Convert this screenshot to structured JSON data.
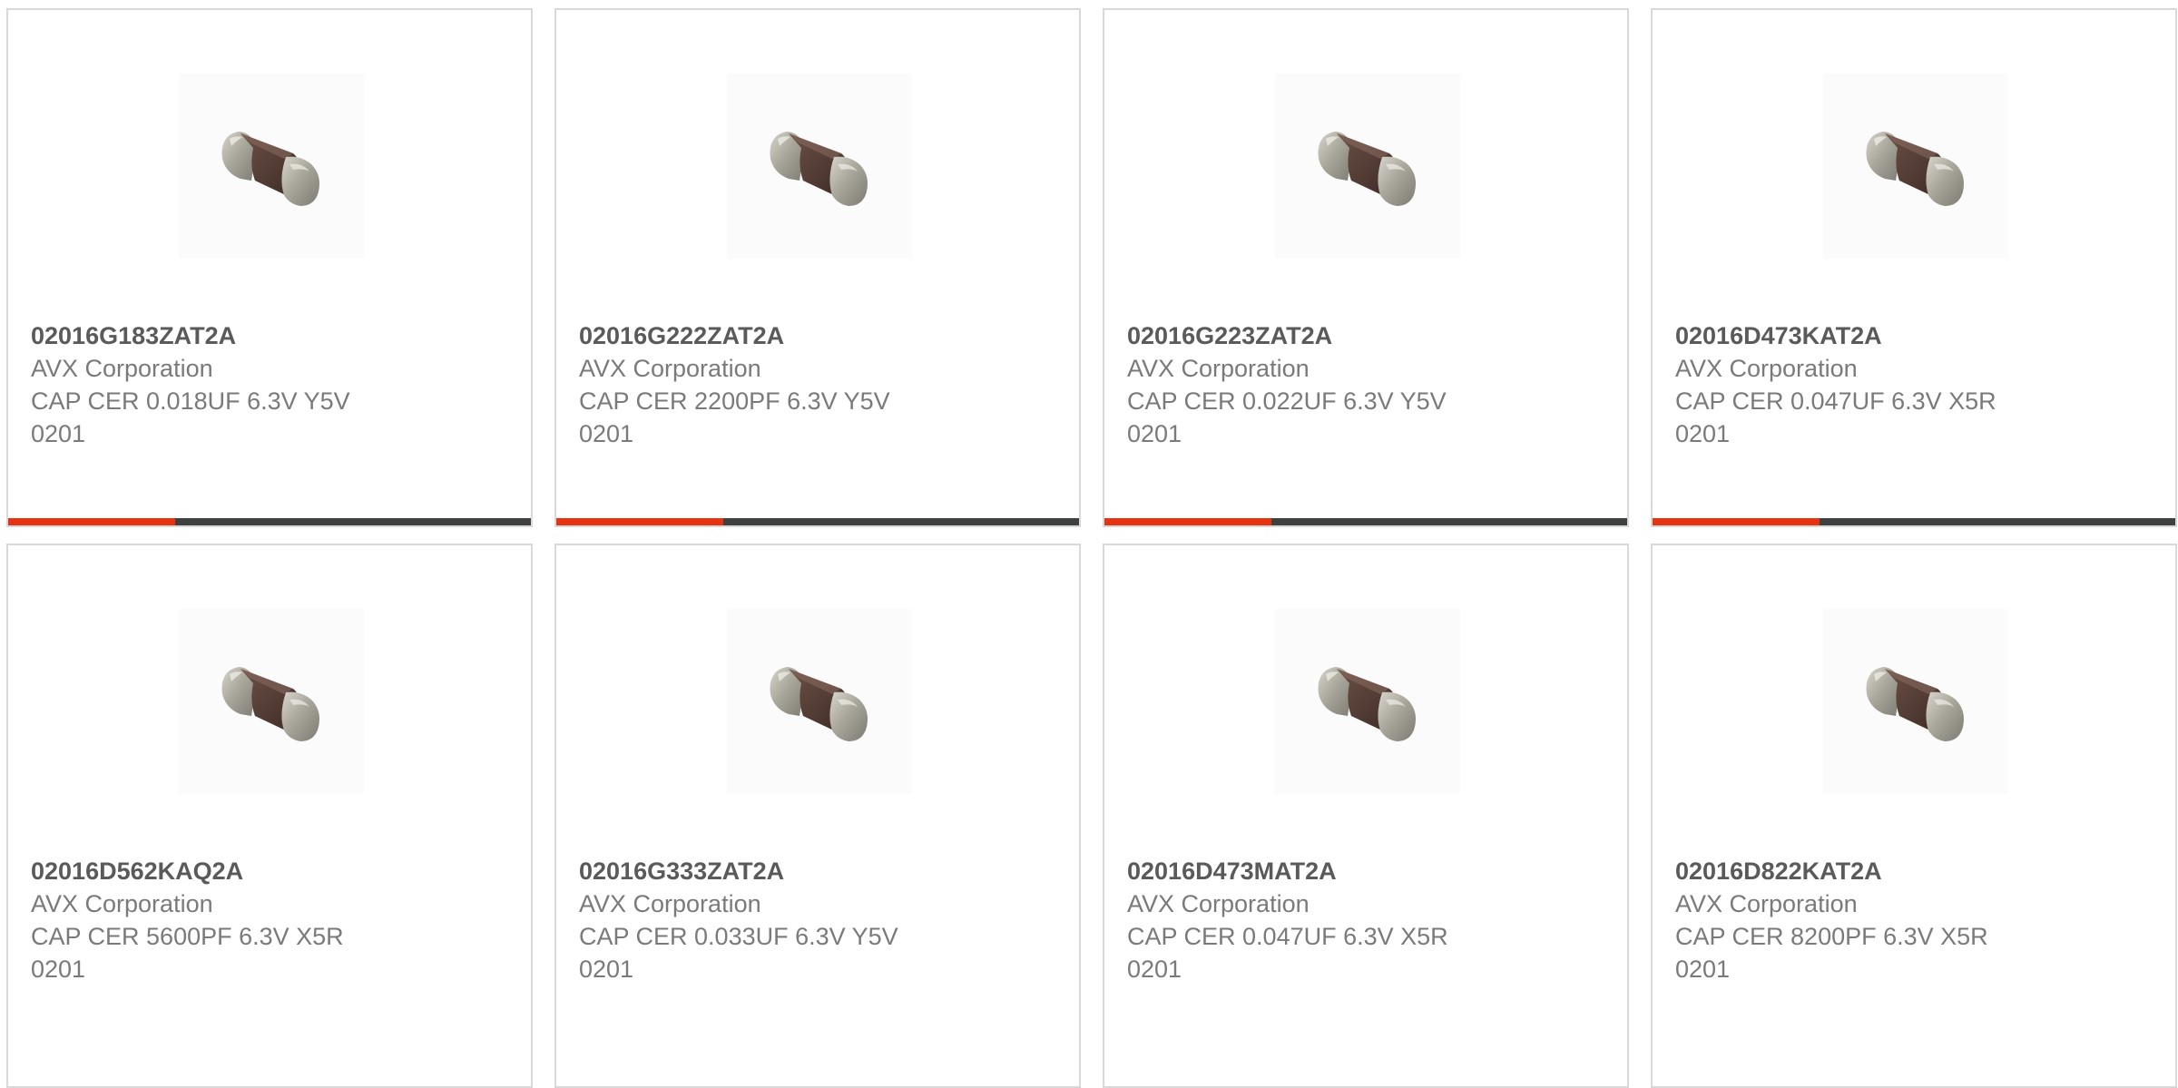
{
  "colors": {
    "accent": "#e63312",
    "bar_track": "#3f4040",
    "border": "#d9d9d9",
    "part_text": "#5a5a5a",
    "body_text": "#7a7a7a"
  },
  "products": [
    {
      "part_number": "02016G183ZAT2A",
      "manufacturer": "AVX Corporation",
      "description": "CAP CER 0.018UF 6.3V Y5V",
      "package": "0201",
      "image_icon": "ceramic-capacitor-chip-icon",
      "bar_fraction": 0.32
    },
    {
      "part_number": "02016G222ZAT2A",
      "manufacturer": "AVX Corporation",
      "description": "CAP CER 2200PF 6.3V Y5V",
      "package": "0201",
      "image_icon": "ceramic-capacitor-chip-icon",
      "bar_fraction": 0.32
    },
    {
      "part_number": "02016G223ZAT2A",
      "manufacturer": "AVX Corporation",
      "description": "CAP CER 0.022UF 6.3V Y5V",
      "package": "0201",
      "image_icon": "ceramic-capacitor-chip-icon",
      "bar_fraction": 0.32
    },
    {
      "part_number": "02016D473KAT2A",
      "manufacturer": "AVX Corporation",
      "description": "CAP CER 0.047UF 6.3V X5R",
      "package": "0201",
      "image_icon": "ceramic-capacitor-chip-icon",
      "bar_fraction": 0.32
    },
    {
      "part_number": "02016D562KAQ2A",
      "manufacturer": "AVX Corporation",
      "description": "CAP CER 5600PF 6.3V X5R",
      "package": "0201",
      "image_icon": "ceramic-capacitor-chip-icon"
    },
    {
      "part_number": "02016G333ZAT2A",
      "manufacturer": "AVX Corporation",
      "description": "CAP CER 0.033UF 6.3V Y5V",
      "package": "0201",
      "image_icon": "ceramic-capacitor-chip-icon"
    },
    {
      "part_number": "02016D473MAT2A",
      "manufacturer": "AVX Corporation",
      "description": "CAP CER 0.047UF 6.3V X5R",
      "package": "0201",
      "image_icon": "ceramic-capacitor-chip-icon"
    },
    {
      "part_number": "02016D822KAT2A",
      "manufacturer": "AVX Corporation",
      "description": "CAP CER 8200PF 6.3V X5R",
      "package": "0201",
      "image_icon": "ceramic-capacitor-chip-icon"
    }
  ]
}
